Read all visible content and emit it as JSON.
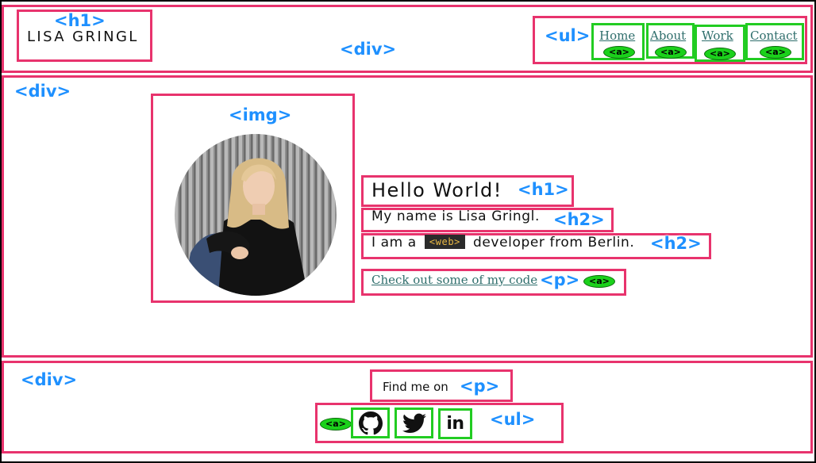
{
  "header": {
    "logo_text": "LISA GRINGL",
    "nav": [
      "Home",
      "About",
      "Work",
      "Contact"
    ]
  },
  "hero": {
    "greeting": "Hello World!",
    "name_line": "My name is Lisa Gringl.",
    "role_prefix": "I am a",
    "role_badge": "<web>",
    "role_suffix": "developer from Berlin.",
    "cta_link": "Check out some of my code"
  },
  "footer": {
    "find_text": "Find me on",
    "social_icons": [
      "github-icon",
      "twitter-icon",
      "linkedin-icon"
    ],
    "linkedin_glyph": "in"
  },
  "annotations": {
    "h1": "<h1>",
    "h2": "<h2>",
    "div": "<div>",
    "ul": "<ul>",
    "img": "<img>",
    "p": "<p>",
    "a": "<a>"
  },
  "colors": {
    "element_box": "#e8336d",
    "link_box": "#22cc22",
    "tag_label": "#1e90ff",
    "link_text": "#2f6e6c",
    "badge_bg": "#2b2b2b",
    "badge_text": "#e8b844"
  }
}
